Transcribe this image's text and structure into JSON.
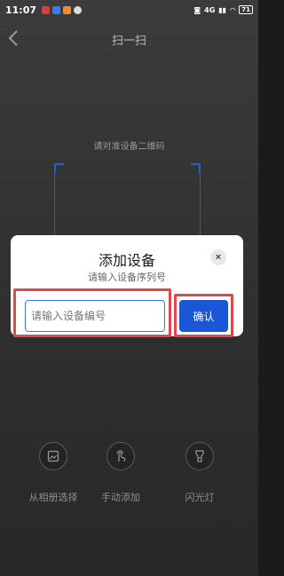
{
  "status_bar": {
    "time": "11:07",
    "network": "4G",
    "battery": "71"
  },
  "nav": {
    "title": "扫一扫"
  },
  "scanner": {
    "hint": "请对准设备二维码"
  },
  "dialog": {
    "title": "添加设备",
    "subtitle": "请输入设备序列号",
    "input_placeholder": "请输入设备编号",
    "input_value": "",
    "confirm_label": "确认",
    "close_label": "×"
  },
  "actions": [
    {
      "label": "从相册选择",
      "icon": "album-icon"
    },
    {
      "label": "手动添加",
      "icon": "hand-tap-icon"
    },
    {
      "label": "闪光灯",
      "icon": "flashlight-icon"
    }
  ],
  "colors": {
    "accent": "#1a56d6",
    "highlight": "#e0484f",
    "frame_corner": "#2a5bd7"
  }
}
